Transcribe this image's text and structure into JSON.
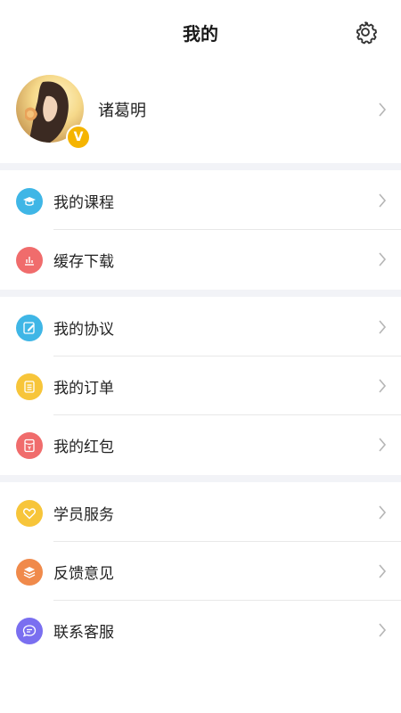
{
  "header": {
    "title": "我的"
  },
  "profile": {
    "name": "诸葛明",
    "badge": "V"
  },
  "groups": [
    {
      "items": [
        {
          "label": "我的课程",
          "icon": "graduation-cap-icon",
          "color": "#3fb6e6"
        },
        {
          "label": "缓存下载",
          "icon": "download-chart-icon",
          "color": "#f06c6c"
        }
      ]
    },
    {
      "items": [
        {
          "label": "我的协议",
          "icon": "edit-document-icon",
          "color": "#3fb6e6"
        },
        {
          "label": "我的订单",
          "icon": "order-list-icon",
          "color": "#f7c53a"
        },
        {
          "label": "我的红包",
          "icon": "red-packet-icon",
          "color": "#f06c6c"
        }
      ]
    },
    {
      "items": [
        {
          "label": "学员服务",
          "icon": "heart-icon",
          "color": "#f7c53a"
        },
        {
          "label": "反馈意见",
          "icon": "feedback-stack-icon",
          "color": "#f08a4b"
        },
        {
          "label": "联系客服",
          "icon": "chat-bubble-icon",
          "color": "#7a6ff0"
        }
      ]
    }
  ]
}
